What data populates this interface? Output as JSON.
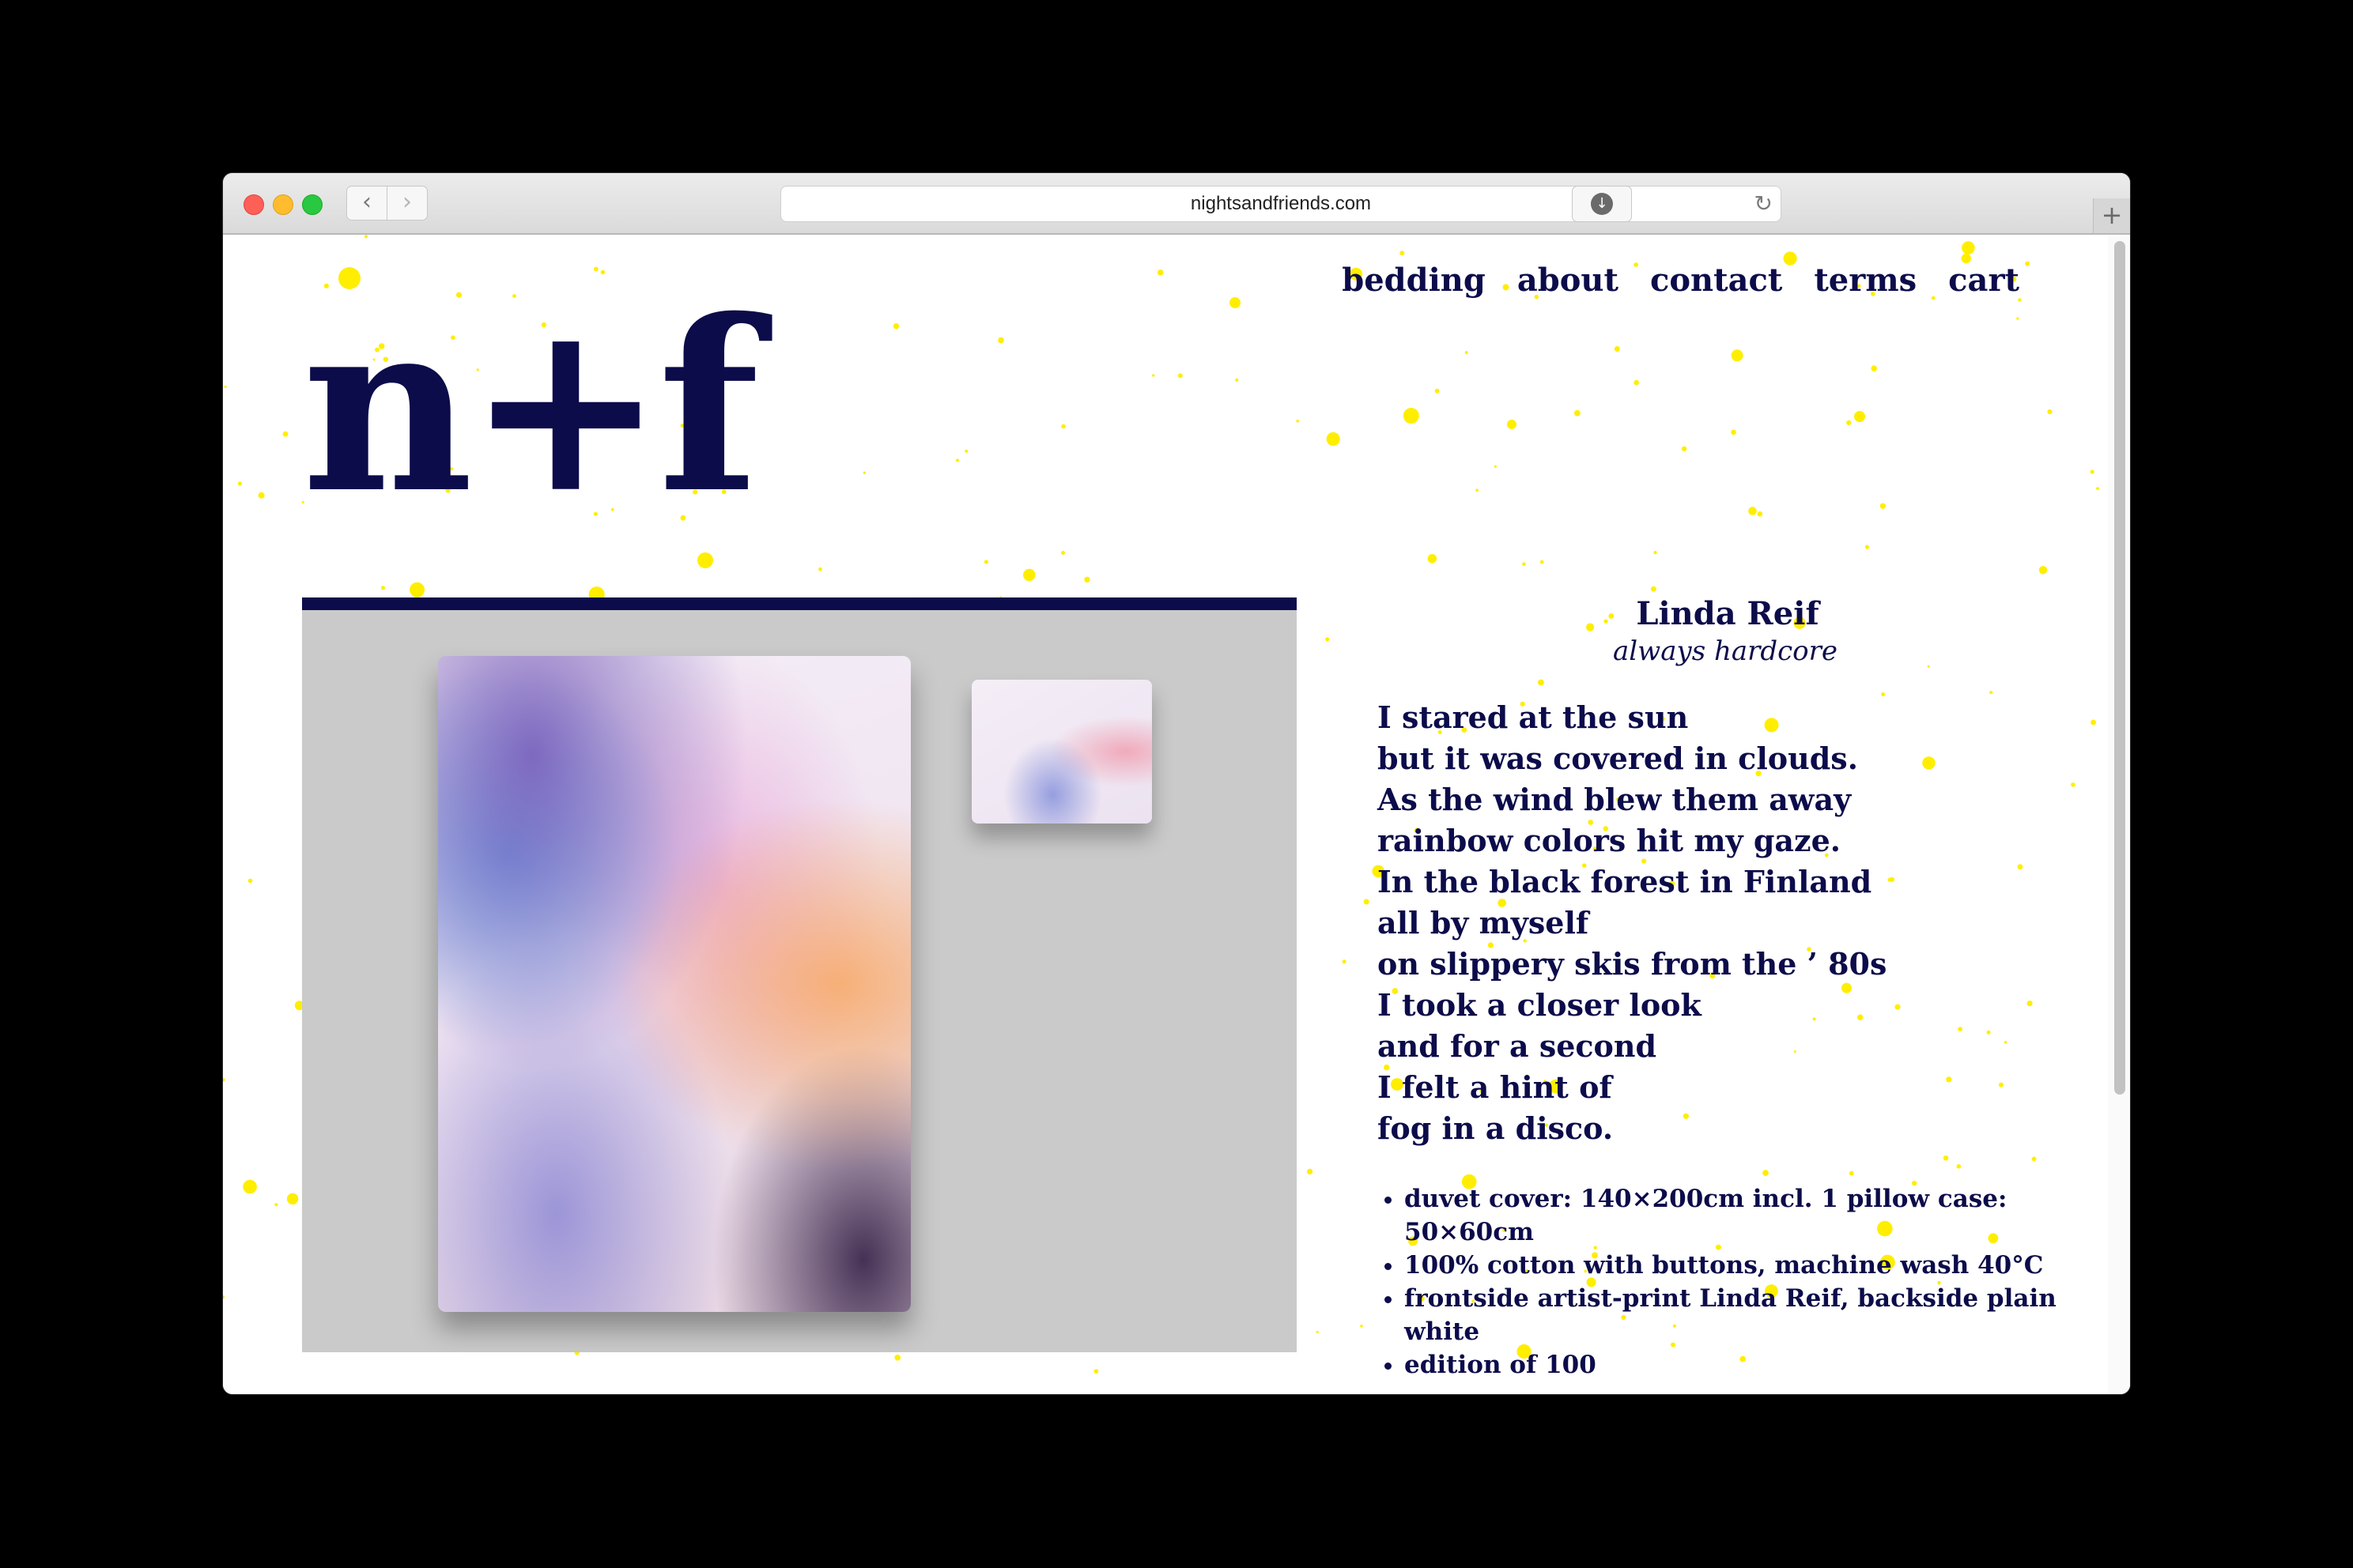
{
  "browser": {
    "url": "nightsandfriends.com",
    "back_icon": "chevron-left-icon",
    "forward_icon": "chevron-right-icon",
    "reload_icon": "reload-icon",
    "download_icon": "download-icon",
    "new_tab_icon": "plus-icon"
  },
  "nav": {
    "items": [
      {
        "label": "bedding"
      },
      {
        "label": "about"
      },
      {
        "label": "contact"
      },
      {
        "label": "terms"
      },
      {
        "label": "cart"
      }
    ]
  },
  "logo": {
    "text": "n+f"
  },
  "product": {
    "artist": "Linda Reif",
    "title": "always hardcore",
    "poem": [
      "I stared at the sun",
      "but it was covered in clouds.",
      "As the wind blew them away",
      "rainbow colors hit my gaze.",
      "In the black forest in Finland",
      "all by myself",
      "on slippery skis from the ’ 80s",
      "I took a closer look",
      "and for a second",
      "I felt a hint of",
      "fog in a disco."
    ],
    "specs": [
      "duvet cover: 140×200cm incl. 1 pillow case: 50×60cm",
      "100% cotton with buttons, machine wash 40°C",
      "frontside artist-print Linda Reif, backside plain white",
      "edition of 100"
    ]
  },
  "colors": {
    "brand_navy": "#0c0c4b",
    "star_yellow": "#ffee00",
    "photo_background": "#cacaca"
  }
}
